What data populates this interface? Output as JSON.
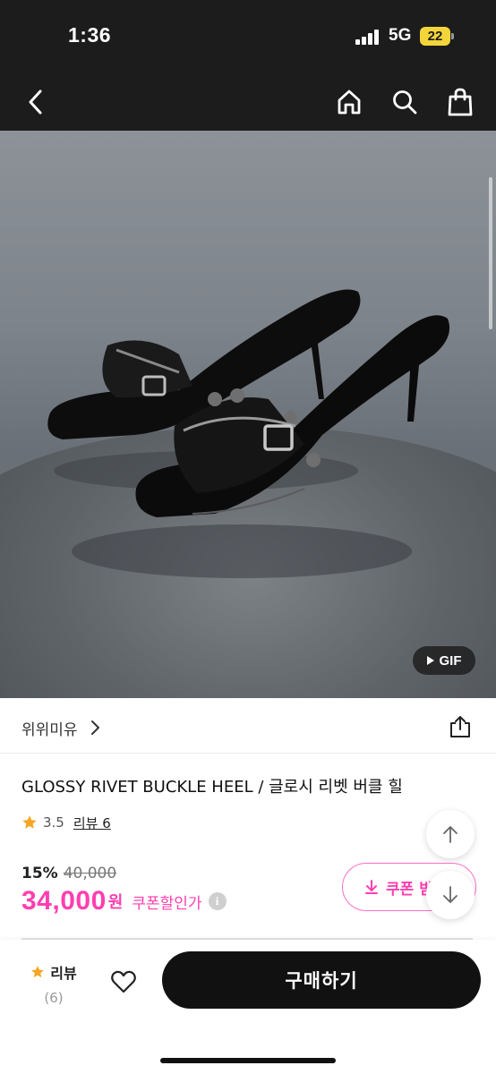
{
  "status_bar": {
    "time": "1:36",
    "network": "5G",
    "battery": "22"
  },
  "nav": {
    "back_icon": "chevron-left-icon",
    "home_icon": "home-icon",
    "search_icon": "search-icon",
    "cart_icon": "shopping-bag-icon"
  },
  "media": {
    "image_alt": "Black glossy rivet buckle heel mules",
    "gif_label": "GIF"
  },
  "brand": {
    "name": "위위미유"
  },
  "product": {
    "title": "GLOSSY RIVET BUCKLE HEEL / 글로시 리벳 버클 힐",
    "rating": "3.5",
    "review_link": "리뷰 6"
  },
  "price": {
    "discount_rate": "15%",
    "original": "40,000",
    "sale": "34,000",
    "currency": "원",
    "coupon_discount": "쿠폰할인가",
    "info_icon": "i"
  },
  "coupon_button": {
    "label": "쿠폰 받"
  },
  "bottom_bar": {
    "review_label": "리뷰",
    "review_count": "(6)",
    "buy_label": "구매하기"
  },
  "colors": {
    "accent_pink": "#ff3fb0",
    "dark": "#1c1c1c",
    "star": "#f5a623"
  }
}
